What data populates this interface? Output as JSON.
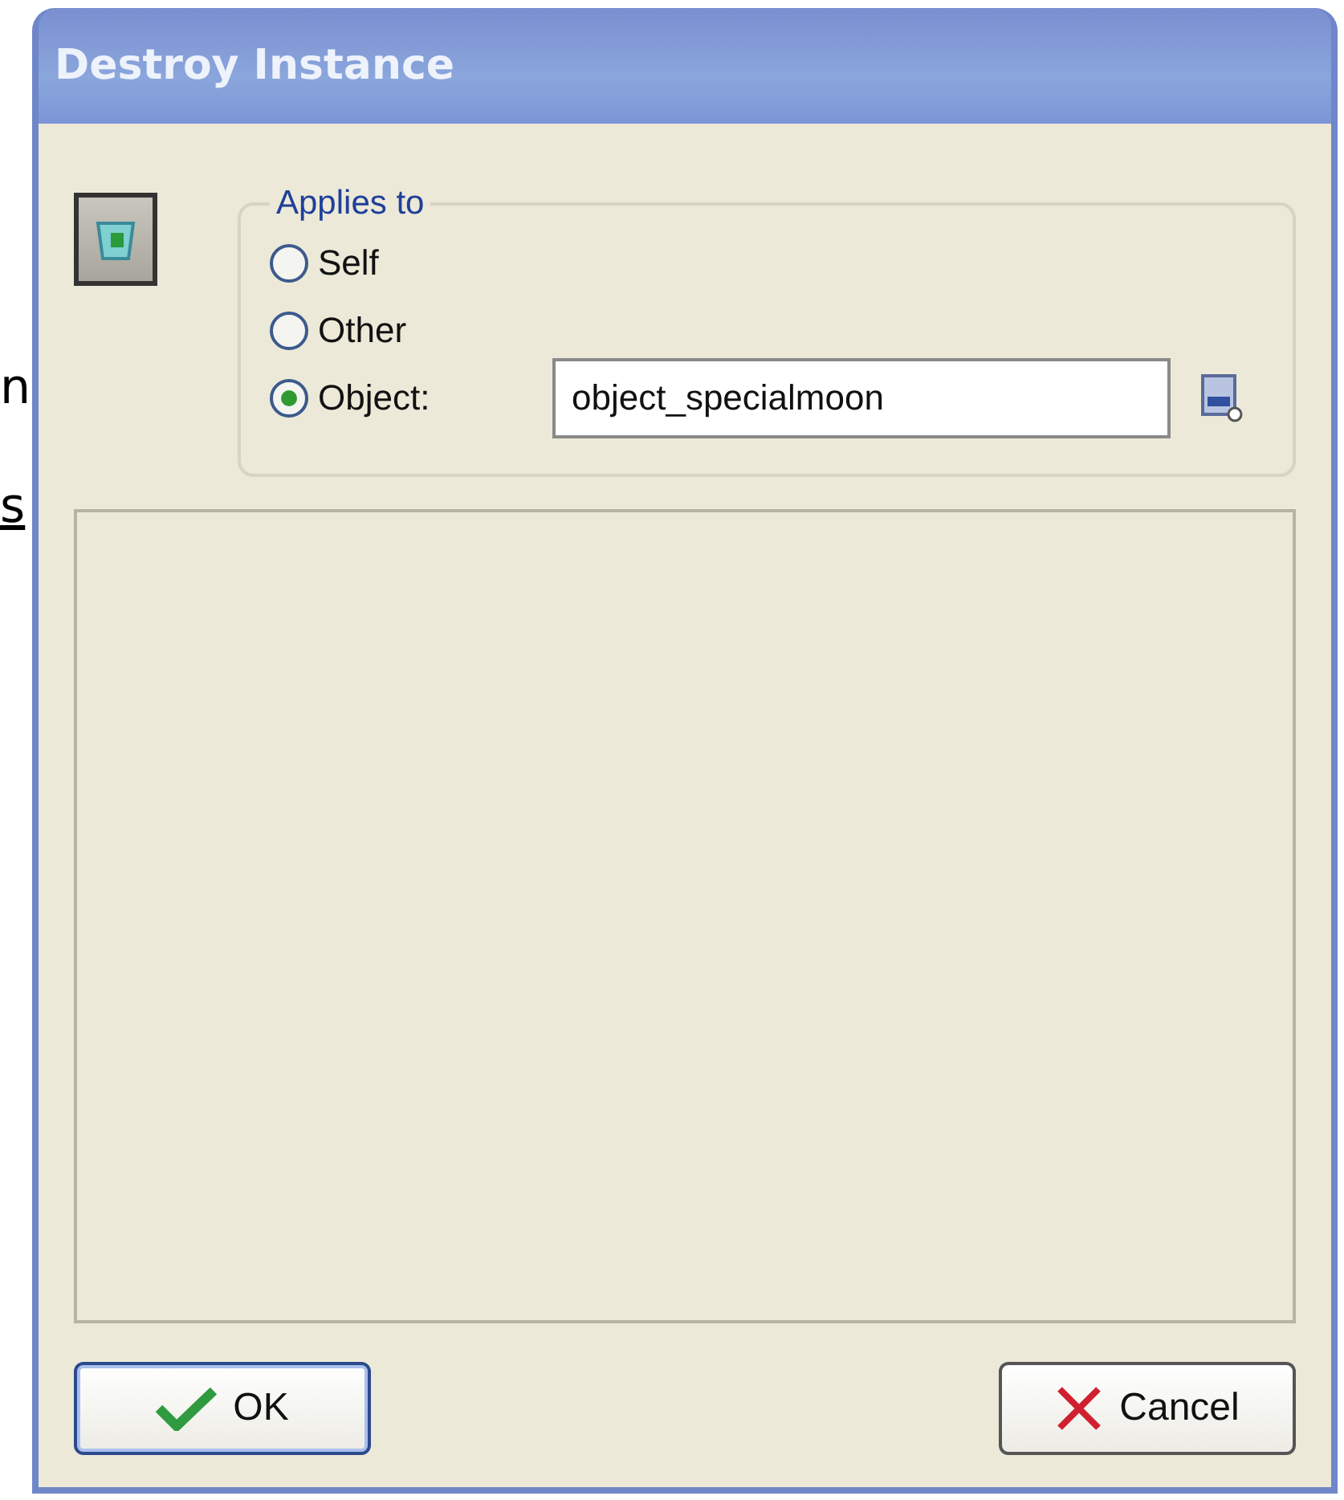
{
  "background_text": [
    "n",
    "s"
  ],
  "window": {
    "title": "Destroy Instance"
  },
  "applies_to": {
    "legend": "Applies to",
    "options": [
      {
        "label": "Self",
        "selected": false
      },
      {
        "label": "Other",
        "selected": false
      },
      {
        "label": "Object:",
        "selected": true
      }
    ],
    "object_field": {
      "value": "object_specialmoon"
    }
  },
  "buttons": [
    {
      "kind": "ok",
      "label": "OK"
    },
    {
      "kind": "cancel",
      "label": "Cancel"
    }
  ]
}
